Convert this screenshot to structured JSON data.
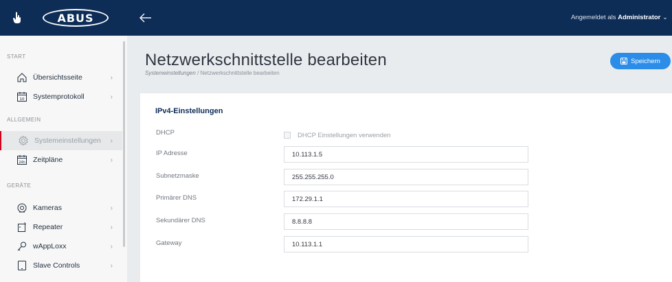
{
  "brand": {
    "logo_text": "ABUS"
  },
  "topbar": {
    "user_prefix": "Angemeldet als",
    "user_name": "Administrator"
  },
  "sidebar": {
    "sections": [
      {
        "label": "START"
      },
      {
        "label": "ALLGEMEIN"
      },
      {
        "label": "GERÄTE"
      }
    ],
    "items": [
      {
        "label": "Übersichtsseite",
        "icon": "home-icon"
      },
      {
        "label": "Systemprotokoll",
        "icon": "calendar-icon"
      },
      {
        "label": "Systemeinstellungen",
        "icon": "gear-icon",
        "active": true
      },
      {
        "label": "Zeitpläne",
        "icon": "schedule-icon"
      },
      {
        "label": "Kameras",
        "icon": "camera-icon"
      },
      {
        "label": "Repeater",
        "icon": "repeater-icon"
      },
      {
        "label": "wAppLoxx",
        "icon": "key-icon"
      },
      {
        "label": "Slave Controls",
        "icon": "tablet-icon"
      }
    ],
    "calendar_day": "10",
    "schedule_number": "24h"
  },
  "page": {
    "title": "Netzwerkschnittstelle bearbeiten",
    "breadcrumb_parent": "Systemeinstellungen",
    "breadcrumb_separator": "/",
    "breadcrumb_current": "Netzwerkschnittstelle bearbeiten",
    "save_label": "Speichern"
  },
  "form": {
    "section_title": "IPv4-Einstellungen",
    "dhcp_label": "DHCP",
    "dhcp_checkbox_label": "DHCP Einstellungen verwenden",
    "dhcp_checked": false,
    "fields": [
      {
        "label": "IP Adresse",
        "value": "10.113.1.5"
      },
      {
        "label": "Subnetzmaske",
        "value": "255.255.255.0"
      },
      {
        "label": "Primärer DNS",
        "value": "172.29.1.1"
      },
      {
        "label": "Sekundärer DNS",
        "value": "8.8.8.8"
      },
      {
        "label": "Gateway",
        "value": "10.113.1.1"
      }
    ]
  },
  "colors": {
    "header_bg": "#0d2c56",
    "accent": "#2b8de8",
    "active_marker": "#d0021b"
  }
}
